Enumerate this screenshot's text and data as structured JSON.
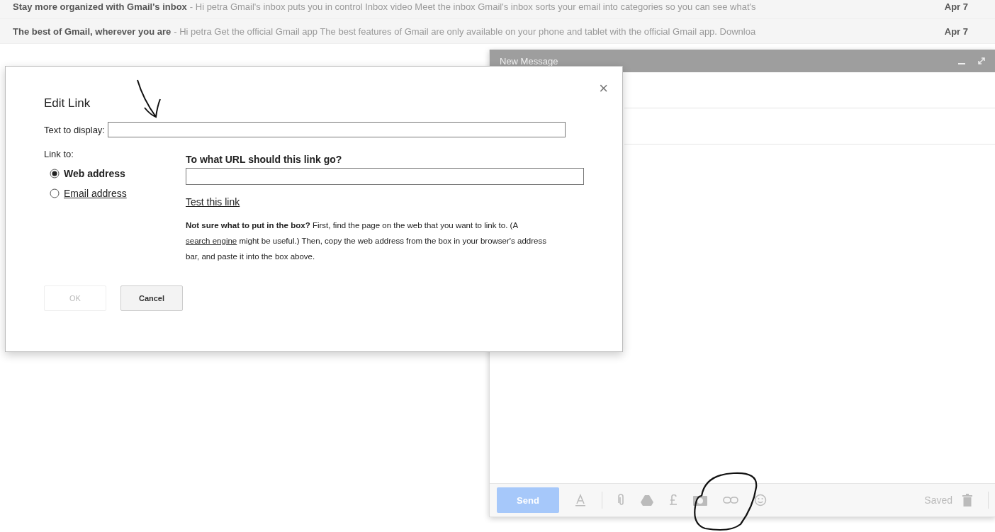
{
  "inbox_rows": [
    {
      "sender_subject": "Stay more organized with Gmail's inbox",
      "snippet": "- Hi petra Gmail's inbox puts you in control Inbox video Meet the inbox Gmail's inbox sorts your email into categories so you can see what's",
      "date": "Apr 7"
    },
    {
      "sender_subject": "The best of Gmail, wherever you are",
      "snippet": "- Hi petra Get the official Gmail app The best features of Gmail are only available on your phone and tablet with the official Gmail app. Downloa",
      "date": "Apr 7"
    }
  ],
  "compose": {
    "title": "New Message",
    "send_button": {
      "label": "Send",
      "disabled": true
    },
    "status": "Saved"
  },
  "dialog": {
    "title": "Edit Link",
    "close": "×",
    "text_label": "Text to display:",
    "link_to_label": "Link to:",
    "link_types": [
      {
        "label": "Web address",
        "selected": true
      },
      {
        "label": "Email address",
        "selected": false
      }
    ],
    "url_heading": "To what URL should this link go?",
    "test_link": "Test this link",
    "help": {
      "lead": "**Not sure what to put in the box?** First, find the page on the web that you want to link to. (A",
      "link": "search engine",
      "rest": "might be useful.) Then, copy the web address from the box in your browser's address bar, and paste it into the box above."
    },
    "buttons": [
      {
        "label": "OK",
        "disabled": true
      },
      {
        "label": "Cancel",
        "disabled": false
      }
    ]
  }
}
